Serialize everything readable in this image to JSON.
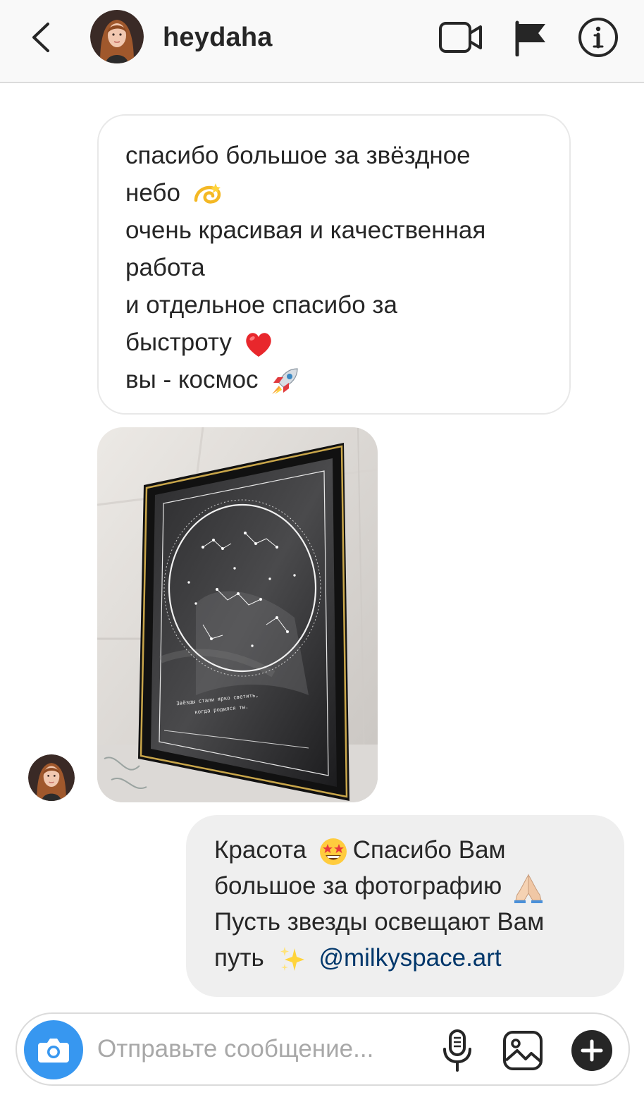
{
  "header": {
    "username": "heydaha",
    "icons": [
      "chevron-left-icon",
      "avatar",
      "video-camera-icon",
      "flag-icon",
      "info-icon"
    ]
  },
  "messages": {
    "incoming_text": {
      "lines": [
        "спасибо большое за звёздное",
        "небо",
        "очень красивая и качественная",
        "работа",
        "и отдельное спасибо за",
        "быстроту",
        "вы - космос"
      ],
      "emojis": [
        "dizzy-emoji",
        "red-heart-emoji",
        "rocket-emoji"
      ]
    },
    "incoming_photo": {
      "framed_text_line1": "Звёзды стали ярко светить,",
      "framed_text_line2": "когда родился ты."
    },
    "outgoing_text": {
      "line1_a": "Красота",
      "line1_b": "Спасибо Вам",
      "line2": "большое за фотографию",
      "line3": "Пусть звезды освещают Вам",
      "line4": "путь",
      "mention": "@milkyspace.art",
      "emojis": [
        "star-struck-emoji",
        "folded-hands-emoji",
        "sparkles-emoji"
      ]
    }
  },
  "composer": {
    "placeholder": "Отправьте сообщение...",
    "icons": [
      "camera-icon",
      "microphone-icon",
      "gallery-icon",
      "plus-icon"
    ]
  },
  "colors": {
    "accent_blue": "#3797f0",
    "mention_blue": "#00376b",
    "outgoing_bubble": "#efefef",
    "header_bg": "#f9f9f9"
  }
}
